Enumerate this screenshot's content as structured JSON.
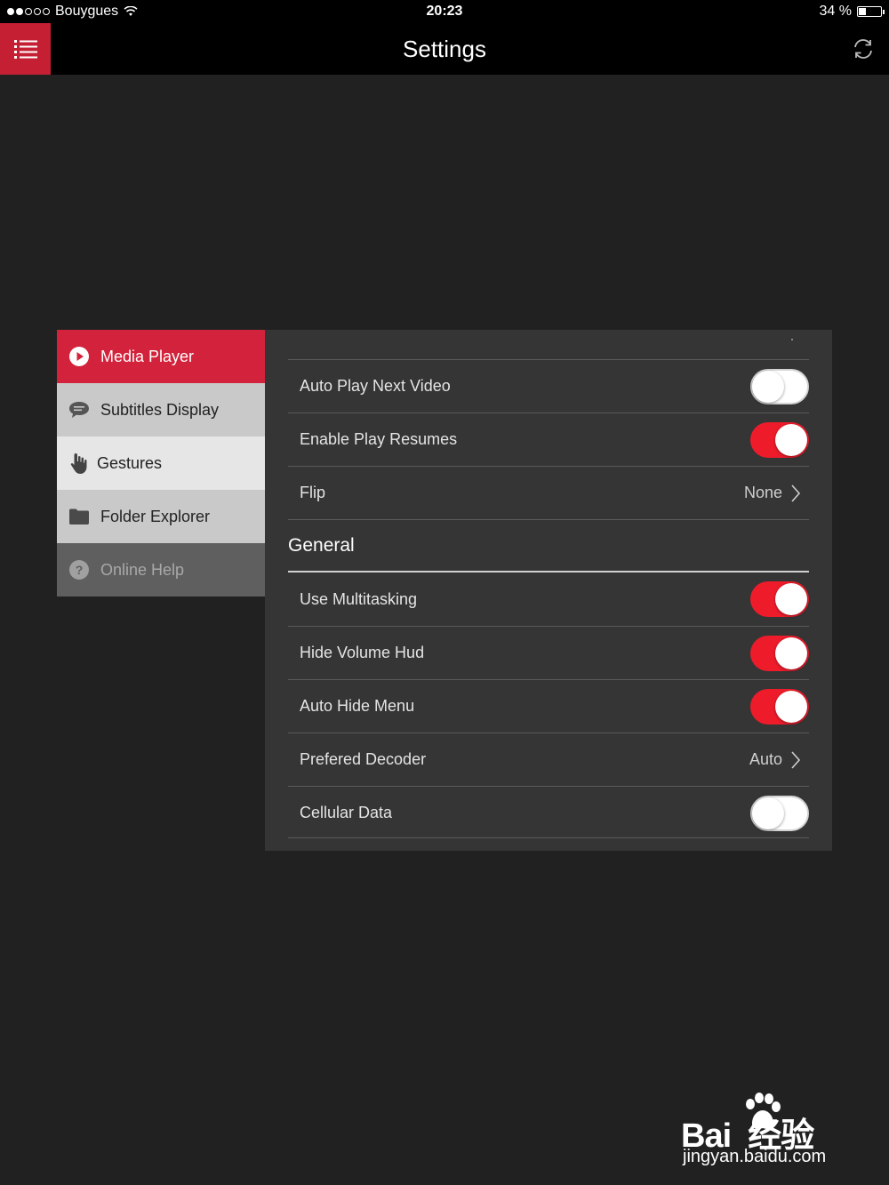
{
  "status_bar": {
    "carrier": "Bouygues",
    "time": "20:23",
    "battery": "34 %",
    "battery_level": 0.34
  },
  "nav": {
    "title": "Settings",
    "menu_icon": "list-icon",
    "sync_icon": "refresh-icon"
  },
  "sidebar": {
    "items": [
      {
        "label": "Media Player",
        "icon": "play-icon"
      },
      {
        "label": "Subtitles Display",
        "icon": "chat-bubble-icon"
      },
      {
        "label": "Gestures",
        "icon": "hand-icon"
      },
      {
        "label": "Folder Explorer",
        "icon": "folder-icon"
      },
      {
        "label": "Online Help",
        "icon": "help-icon"
      }
    ]
  },
  "media_player": {
    "rows": [
      {
        "label": "Auto Play Next Video",
        "toggle": false
      },
      {
        "label": "Enable Play Resumes",
        "toggle": true
      },
      {
        "label": "Flip",
        "value": "None"
      }
    ]
  },
  "general": {
    "title": "General",
    "rows": [
      {
        "label": "Use Multitasking",
        "toggle": true
      },
      {
        "label": "Hide Volume Hud",
        "toggle": true
      },
      {
        "label": "Auto Hide Menu",
        "toggle": true
      },
      {
        "label": "Prefered Decoder",
        "value": "Auto"
      },
      {
        "label": "Cellular Data",
        "toggle": false
      }
    ]
  },
  "watermark": {
    "brand": "Bai  经验",
    "url": "jingyan.baidu.com"
  },
  "colors": {
    "accent": "#d3223b",
    "toggle_on": "#ee1c2b",
    "panel": "#353535",
    "background": "#212121"
  }
}
